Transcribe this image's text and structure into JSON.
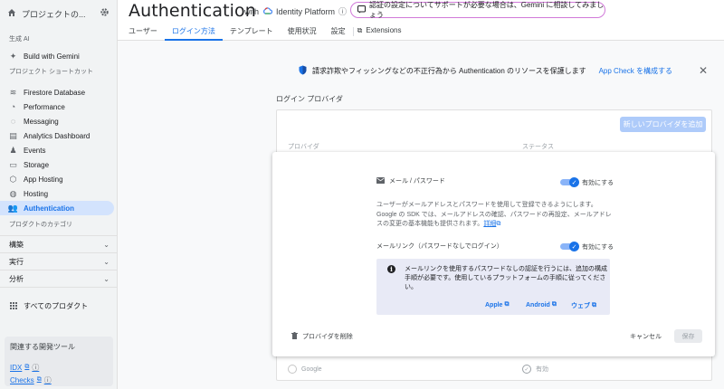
{
  "sidebar": {
    "project_name": "プロジェクトの...",
    "ai_section": "生成 AI",
    "gemini_item": "Build with Gemini",
    "shortcuts_section": "プロジェクト ショートカット",
    "items": [
      {
        "label": "Firestore Database",
        "icon": "firestore-icon"
      },
      {
        "label": "Performance",
        "icon": "performance-icon"
      },
      {
        "label": "Messaging",
        "icon": "messaging-icon"
      },
      {
        "label": "Analytics Dashboard",
        "icon": "analytics-icon"
      },
      {
        "label": "Events",
        "icon": "events-icon"
      },
      {
        "label": "Storage",
        "icon": "storage-icon"
      },
      {
        "label": "App Hosting",
        "icon": "app-hosting-icon"
      },
      {
        "label": "Hosting",
        "icon": "hosting-icon"
      },
      {
        "label": "Authentication",
        "icon": "authentication-icon",
        "active": true
      }
    ],
    "category_section": "プロダクトのカテゴリ",
    "categories": [
      "構築",
      "実行",
      "分析"
    ],
    "all_products": "すべてのプロダクト",
    "dev_tools": {
      "title": "関連する開発ツール",
      "links": [
        "IDX",
        "Checks"
      ]
    }
  },
  "header": {
    "title": "Authentication",
    "with_text": "with",
    "platform": "Identity Platform",
    "gemini_prompt": "認証の設定についてサポートが必要な場合は、Gemini に相談してみましょう",
    "tabs": [
      "ユーザー",
      "ログイン方法",
      "テンプレート",
      "使用状況",
      "設定",
      "Extensions"
    ],
    "active_tab": "ログイン方法"
  },
  "banner": {
    "text": "請求詐欺やフィッシングなどの不正行為から Authentication のリソースを保護します",
    "link": "App Check を構成する"
  },
  "providers": {
    "section_label": "ログイン プロバイダ",
    "new_button": "新しいプロバイダを追加",
    "col_provider": "プロバイダ",
    "col_status": "ステータス",
    "google_row": {
      "name": "Google",
      "status": "有効"
    }
  },
  "panel": {
    "email_password_label": "メール / パスワード",
    "enable_label": "有効にする",
    "description": "ユーザーがメールアドレスとパスワードを使用して登録できるようにします。Google の SDK では、メールアドレスの確認、パスワードの再設定、メールアドレスの変更の基本機能も提供されます。",
    "details_link": "詳細",
    "email_link_label": "メールリンク（パスワードなしでログイン）",
    "enable_label_2": "有効にする",
    "info_text": "メールリンクを使用するパスワードなしの認証を行うには、追加の構成手順が必要です。使用しているプラットフォームの手順に従ってください。",
    "platform_links": [
      "Apple",
      "Android",
      "ウェブ"
    ],
    "delete_label": "プロバイダを削除",
    "cancel_label": "キャンセル",
    "save_label": "保存"
  },
  "colors": {
    "accent": "#1a73e8",
    "active_nav_bg": "#d3e3fd",
    "gemini_border": "#d17ad9"
  }
}
